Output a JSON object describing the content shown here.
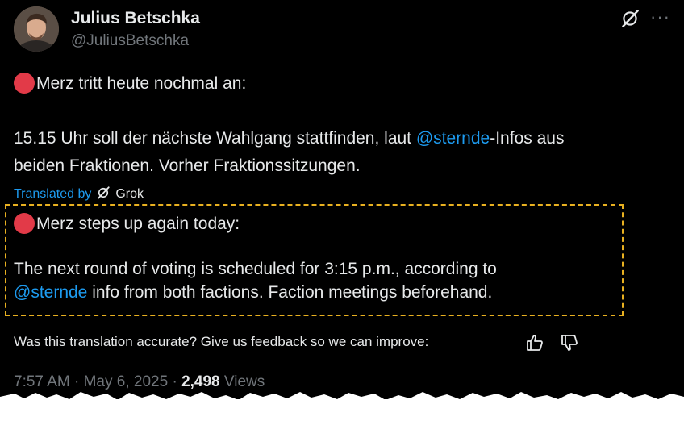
{
  "author": {
    "name": "Julius Betschka",
    "handle": "@JuliusBetschka"
  },
  "header_icons": [
    "grok-icon",
    "more-icon"
  ],
  "original": {
    "line1": "Merz tritt heute nochmal an:",
    "line2_before": "15.15 Uhr soll der nächste Wahlgang stattfinden, laut ",
    "line2_mention": "@sternde",
    "line2_after": "-Infos aus",
    "line3": "beiden Fraktionen. Vorher Fraktionssitzungen."
  },
  "translation": {
    "label": "Translated by",
    "provider": "Grok",
    "line1": "Merz steps up again today:",
    "line2": "The next round of voting is scheduled for 3:15 p.m., according to",
    "line3_mention": "@sternde",
    "line3_after": " info from both factions. Faction meetings beforehand.",
    "box_color": "#e8b020"
  },
  "feedback": {
    "prompt": "Was this translation accurate? Give us feedback so we can improve:"
  },
  "meta": {
    "time": "7:57 AM",
    "separator": " · ",
    "date": "May 6, 2025",
    "views_count": "2,498",
    "views_label": " Views"
  },
  "colors": {
    "background": "#000000",
    "text": "#e7e9ea",
    "secondary": "#71767b",
    "link": "#1d9bf0",
    "red_dot": "#e23a48"
  }
}
